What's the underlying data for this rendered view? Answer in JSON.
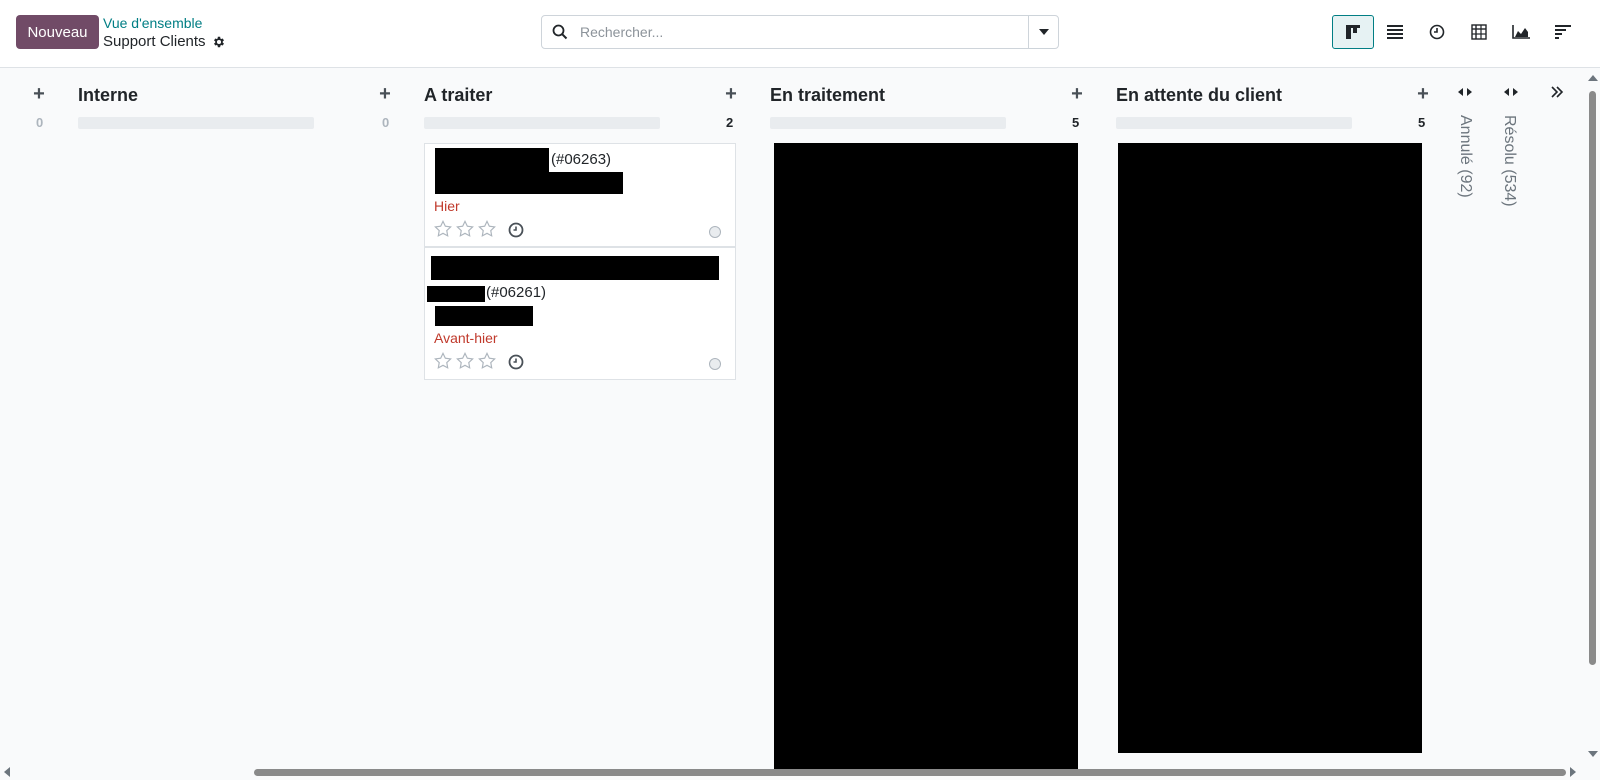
{
  "header": {
    "new_button": "Nouveau",
    "breadcrumb_parent": "Vue d'ensemble",
    "breadcrumb_current": "Support Clients",
    "search_placeholder": "Rechercher..."
  },
  "views": [
    "kanban",
    "list",
    "activity",
    "pivot",
    "graph",
    "cohort"
  ],
  "columns": [
    {
      "title": "Interne",
      "count": "0"
    },
    {
      "title": "A traiter",
      "count": "2"
    },
    {
      "title": "En traitement",
      "count": "5"
    },
    {
      "title": "En attente du client",
      "count": "5"
    }
  ],
  "cards": [
    {
      "ref": "(#06263)",
      "deadline": "Hier"
    },
    {
      "ref": "(#06261)",
      "deadline": "Avant-hier"
    }
  ],
  "folded_columns": [
    {
      "label": "Annulé (92)"
    },
    {
      "label": "Résolu (534)"
    }
  ],
  "colors": {
    "brand": "#714b67",
    "accent": "#017e84",
    "overdue": "#c0392b"
  }
}
